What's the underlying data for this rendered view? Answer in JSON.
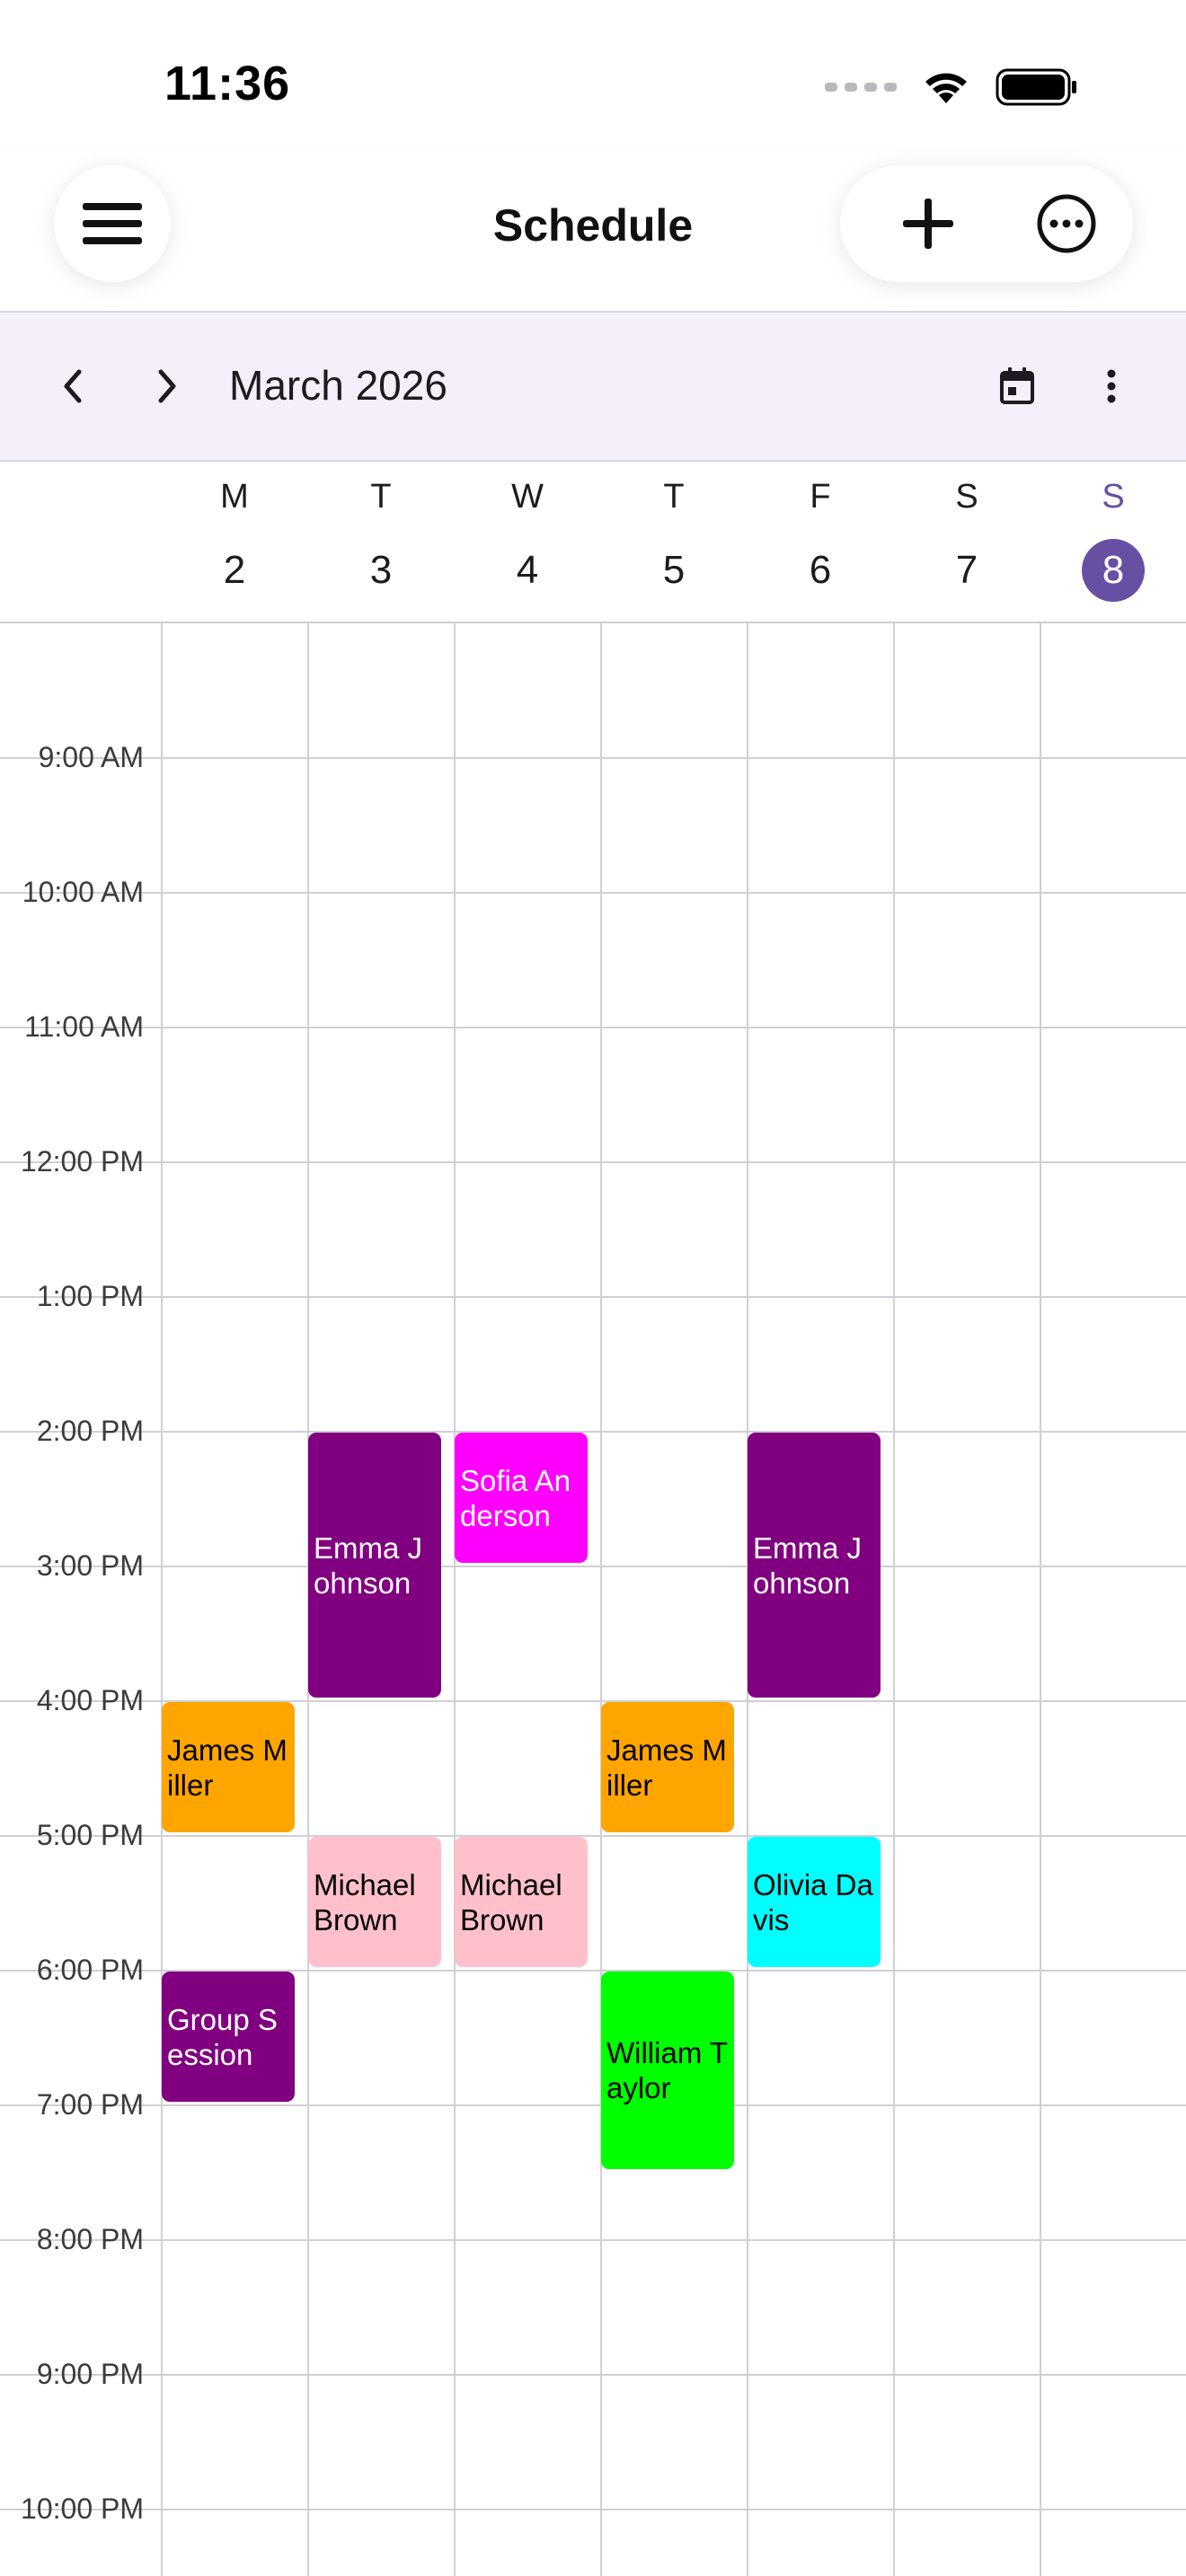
{
  "status_bar": {
    "time": "11:36"
  },
  "app_bar": {
    "title": "Schedule"
  },
  "calendar_header": {
    "month": "March 2026"
  },
  "days": [
    {
      "letter": "M",
      "number": "2",
      "today": false
    },
    {
      "letter": "T",
      "number": "3",
      "today": false
    },
    {
      "letter": "W",
      "number": "4",
      "today": false
    },
    {
      "letter": "T",
      "number": "5",
      "today": false
    },
    {
      "letter": "F",
      "number": "6",
      "today": false
    },
    {
      "letter": "S",
      "number": "7",
      "today": false
    },
    {
      "letter": "S",
      "number": "8",
      "today": true
    }
  ],
  "time_labels": [
    "9:00 AM",
    "10:00 AM",
    "11:00 AM",
    "12:00 PM",
    "1:00 PM",
    "2:00 PM",
    "3:00 PM",
    "4:00 PM",
    "5:00 PM",
    "6:00 PM",
    "7:00 PM",
    "8:00 PM",
    "9:00 PM",
    "10:00 PM"
  ],
  "events": [
    {
      "title": "Emma Johnson",
      "day": 1,
      "start": 14,
      "end": 16,
      "color": "#800080",
      "text_color": "#ffffff"
    },
    {
      "title": "Sofia Anderson",
      "day": 2,
      "start": 14,
      "end": 15,
      "color": "#ff00ff",
      "text_color": "#ffffff"
    },
    {
      "title": "Emma Johnson",
      "day": 4,
      "start": 14,
      "end": 16,
      "color": "#800080",
      "text_color": "#ffffff"
    },
    {
      "title": "James Miller",
      "day": 0,
      "start": 16,
      "end": 17,
      "color": "#ffa500",
      "text_color": "#000000"
    },
    {
      "title": "James Miller",
      "day": 3,
      "start": 16,
      "end": 17,
      "color": "#ffa500",
      "text_color": "#000000"
    },
    {
      "title": "Michael Brown",
      "day": 1,
      "start": 17,
      "end": 18,
      "color": "#ffc0cb",
      "text_color": "#000000"
    },
    {
      "title": "Michael Brown",
      "day": 2,
      "start": 17,
      "end": 18,
      "color": "#ffc0cb",
      "text_color": "#000000"
    },
    {
      "title": "Olivia Davis",
      "day": 4,
      "start": 17,
      "end": 18,
      "color": "#00ffff",
      "text_color": "#000000"
    },
    {
      "title": "Group Session",
      "day": 0,
      "start": 18,
      "end": 19,
      "color": "#800080",
      "text_color": "#ffffff"
    },
    {
      "title": "William Taylor",
      "day": 3,
      "start": 18,
      "end": 19.5,
      "color": "#00ff00",
      "text_color": "#000000"
    }
  ]
}
